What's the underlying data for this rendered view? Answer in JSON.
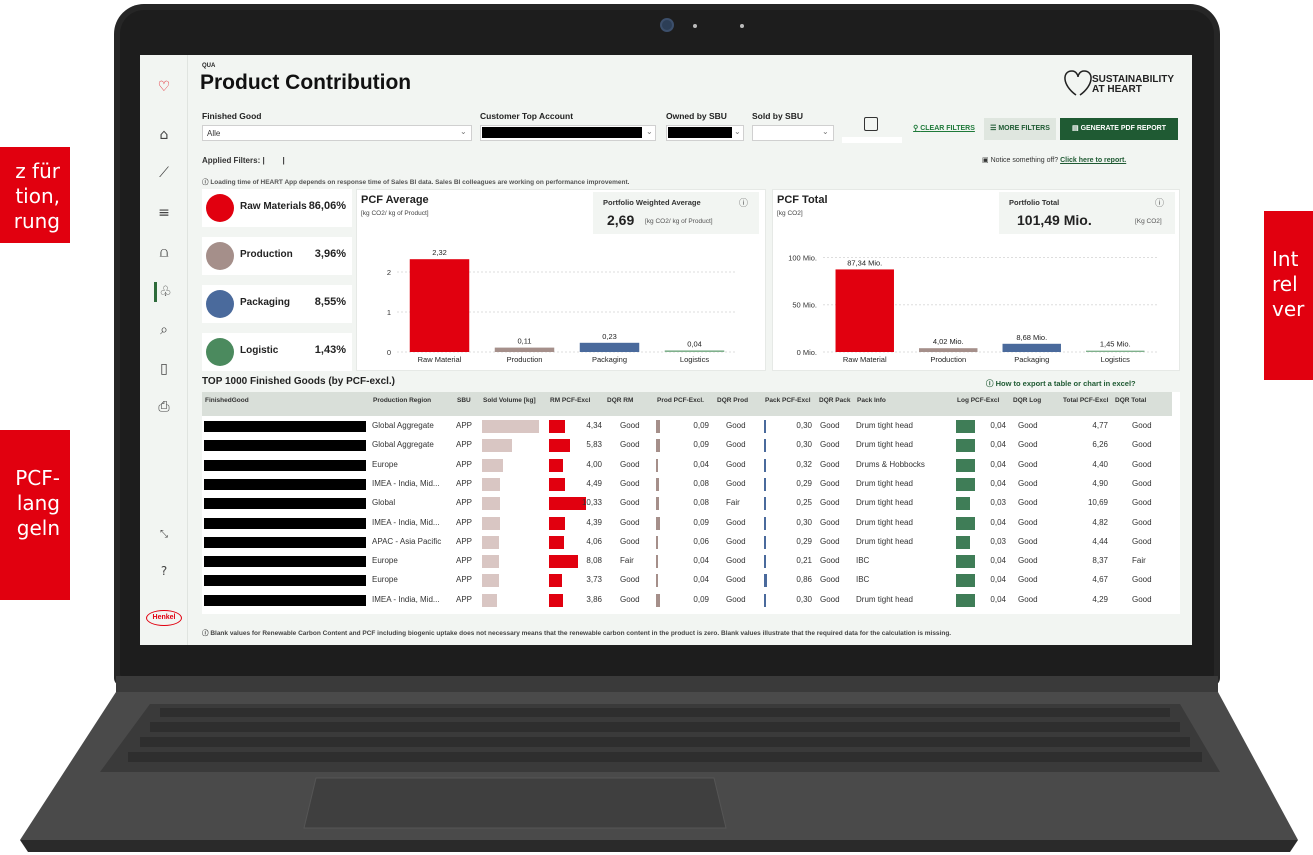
{
  "left_callouts": [
    "z für",
    "tion,",
    "rung",
    "PCF-",
    "lang",
    "geln"
  ],
  "right_callout": [
    "Int",
    "rel",
    "ver"
  ],
  "sidebar": {
    "icons": [
      "heart-icon",
      "home-icon",
      "trend-icon",
      "layers-icon",
      "bag-icon",
      "product-icon",
      "growth-icon",
      "grid-icon",
      "print-icon",
      "expand-icon",
      "help-icon"
    ],
    "brand": "Henkel"
  },
  "header": {
    "qua": "QUA",
    "title": "Product Contribution",
    "logo_text": "SUSTAINABILITY AT HEART"
  },
  "filters": {
    "finished_good": {
      "label": "Finished Good",
      "value": "Alle"
    },
    "customer_top_account": {
      "label": "Customer Top Account"
    },
    "owned_by_sbu": {
      "label": "Owned by SBU"
    },
    "sold_by_sbu": {
      "label": "Sold by SBU"
    },
    "clear_filters": "CLEAR FILTERS",
    "more_filters": "MORE FILTERS",
    "generate_report": "GENERATE PDF REPORT",
    "applied_filters": "Applied Filters: |        |",
    "notice_text": "Notice something off?",
    "notice_link": "Click here to report.",
    "loading_info": "Loading time of HEART App depends on response time of Sales BI data. Sales BI colleagues are working on performance improvement."
  },
  "categories": [
    {
      "label": "Raw Materials",
      "value": "86,06%",
      "color": "#e1000f"
    },
    {
      "label": "Production",
      "value": "3,96%",
      "color": "#a58f8a"
    },
    {
      "label": "Packaging",
      "value": "8,55%",
      "color": "#4a6a9c"
    },
    {
      "label": "Logistic",
      "value": "1,43%",
      "color": "#4b8a5e"
    }
  ],
  "pcf_average": {
    "title": "PCF Average",
    "unit": "[kg CO2/ kg of Product]",
    "kpi_label": "Portfolio Weighted Average",
    "kpi_value": "2,69",
    "kpi_unit": "[kg CO2/ kg of Product]",
    "y_ticks": [
      "2",
      "1",
      "0"
    ]
  },
  "pcf_total": {
    "title": "PCF Total",
    "unit": "[kg CO2]",
    "kpi_label": "Portfolio Total",
    "kpi_value": "101,49 Mio.",
    "kpi_unit": "[Kg CO2]",
    "y_ticks": [
      "100 Mio.",
      "50 Mio.",
      "0 Mio."
    ]
  },
  "chart_data": [
    {
      "type": "bar",
      "title": "PCF Average",
      "ylabel": "[kg CO2/ kg of Product]",
      "categories": [
        "Raw Material",
        "Production",
        "Packaging",
        "Logistics"
      ],
      "values": [
        2.32,
        0.11,
        0.23,
        0.04
      ],
      "labels": [
        "2,32",
        "0,11",
        "0,23",
        "0,04"
      ],
      "colors": [
        "#e1000f",
        "#a58f8a",
        "#4a6a9c",
        "#7fb08c"
      ],
      "ylim": [
        0,
        2.6
      ]
    },
    {
      "type": "bar",
      "title": "PCF Total",
      "ylabel": "[kg CO2]",
      "categories": [
        "Raw Material",
        "Production",
        "Packaging",
        "Logistics"
      ],
      "values": [
        87.34,
        4.02,
        8.68,
        1.45
      ],
      "labels": [
        "87,34 Mio.",
        "4,02 Mio.",
        "8,68 Mio.",
        "1,45 Mio."
      ],
      "colors": [
        "#e1000f",
        "#a58f8a",
        "#4a6a9c",
        "#7fb08c"
      ],
      "ylim": [
        0,
        110
      ]
    }
  ],
  "table": {
    "title": "TOP 1000 Finished Goods (by PCF-excl.)",
    "export_link": "How to export a table or chart in excel?",
    "columns": [
      "FinishedGood",
      "Production Region",
      "SBU",
      "Sold Volume [kg]",
      "RM PCF-Excl",
      "DQR RM",
      "Prod PCF-Excl.",
      "DQR Prod",
      "Pack PCF-Excl",
      "DQR Pack",
      "Pack Info",
      "Log PCF-Excl",
      "DQR Log",
      "Total PCF-Excl",
      "DQR Total"
    ],
    "rows": [
      {
        "region": "Global Aggregate",
        "sbu": "APP",
        "vol": 0.95,
        "rm": "4,34",
        "rm_v": 4.34,
        "dqr_rm": "Good",
        "prod": "0,09",
        "prod_v": 0.09,
        "dqr_prod": "Good",
        "pack": "0,30",
        "pack_v": 0.3,
        "dqr_pack": "Good",
        "info": "Drum tight head",
        "log": "0,04",
        "log_v": 0.04,
        "dqr_log": "Good",
        "total": "4,77",
        "dqr_total": "Good"
      },
      {
        "region": "Global Aggregate",
        "sbu": "APP",
        "vol": 0.5,
        "rm": "5,83",
        "rm_v": 5.83,
        "dqr_rm": "Good",
        "prod": "0,09",
        "prod_v": 0.09,
        "dqr_prod": "Good",
        "pack": "0,30",
        "pack_v": 0.3,
        "dqr_pack": "Good",
        "info": "Drum tight head",
        "log": "0,04",
        "log_v": 0.04,
        "dqr_log": "Good",
        "total": "6,26",
        "dqr_total": "Good"
      },
      {
        "region": "Europe",
        "sbu": "APP",
        "vol": 0.35,
        "rm": "4,00",
        "rm_v": 4.0,
        "dqr_rm": "Good",
        "prod": "0,04",
        "prod_v": 0.04,
        "dqr_prod": "Good",
        "pack": "0,32",
        "pack_v": 0.32,
        "dqr_pack": "Good",
        "info": "Drums & Hobbocks",
        "log": "0,04",
        "log_v": 0.04,
        "dqr_log": "Good",
        "total": "4,40",
        "dqr_total": "Good"
      },
      {
        "region": "IMEA - India, Mid...",
        "sbu": "APP",
        "vol": 0.3,
        "rm": "4,49",
        "rm_v": 4.49,
        "dqr_rm": "Good",
        "prod": "0,08",
        "prod_v": 0.08,
        "dqr_prod": "Good",
        "pack": "0,29",
        "pack_v": 0.29,
        "dqr_pack": "Good",
        "info": "Drum tight head",
        "log": "0,04",
        "log_v": 0.04,
        "dqr_log": "Good",
        "total": "4,90",
        "dqr_total": "Good"
      },
      {
        "region": "Global",
        "sbu": "APP",
        "vol": 0.3,
        "rm": "10,33",
        "rm_v": 10.33,
        "dqr_rm": "Good",
        "prod": "0,08",
        "prod_v": 0.08,
        "dqr_prod": "Fair",
        "pack": "0,25",
        "pack_v": 0.25,
        "dqr_pack": "Good",
        "info": "Drum tight head",
        "log": "0,03",
        "log_v": 0.03,
        "dqr_log": "Good",
        "total": "10,69",
        "dqr_total": "Good"
      },
      {
        "region": "IMEA - India, Mid...",
        "sbu": "APP",
        "vol": 0.3,
        "rm": "4,39",
        "rm_v": 4.39,
        "dqr_rm": "Good",
        "prod": "0,09",
        "prod_v": 0.09,
        "dqr_prod": "Good",
        "pack": "0,30",
        "pack_v": 0.3,
        "dqr_pack": "Good",
        "info": "Drum tight head",
        "log": "0,04",
        "log_v": 0.04,
        "dqr_log": "Good",
        "total": "4,82",
        "dqr_total": "Good"
      },
      {
        "region": "APAC - Asia Pacific",
        "sbu": "APP",
        "vol": 0.28,
        "rm": "4,06",
        "rm_v": 4.06,
        "dqr_rm": "Good",
        "prod": "0,06",
        "prod_v": 0.06,
        "dqr_prod": "Good",
        "pack": "0,29",
        "pack_v": 0.29,
        "dqr_pack": "Good",
        "info": "Drum tight head",
        "log": "0,03",
        "log_v": 0.03,
        "dqr_log": "Good",
        "total": "4,44",
        "dqr_total": "Good"
      },
      {
        "region": "Europe",
        "sbu": "APP",
        "vol": 0.28,
        "rm": "8,08",
        "rm_v": 8.08,
        "dqr_rm": "Fair",
        "prod": "0,04",
        "prod_v": 0.04,
        "dqr_prod": "Good",
        "pack": "0,21",
        "pack_v": 0.21,
        "dqr_pack": "Good",
        "info": "IBC",
        "log": "0,04",
        "log_v": 0.04,
        "dqr_log": "Good",
        "total": "8,37",
        "dqr_total": "Fair"
      },
      {
        "region": "Europe",
        "sbu": "APP",
        "vol": 0.28,
        "rm": "3,73",
        "rm_v": 3.73,
        "dqr_rm": "Good",
        "prod": "0,04",
        "prod_v": 0.04,
        "dqr_prod": "Good",
        "pack": "0,86",
        "pack_v": 0.86,
        "dqr_pack": "Good",
        "info": "IBC",
        "log": "0,04",
        "log_v": 0.04,
        "dqr_log": "Good",
        "total": "4,67",
        "dqr_total": "Good"
      },
      {
        "region": "IMEA - India, Mid...",
        "sbu": "APP",
        "vol": 0.25,
        "rm": "3,86",
        "rm_v": 3.86,
        "dqr_rm": "Good",
        "prod": "0,09",
        "prod_v": 0.09,
        "dqr_prod": "Good",
        "pack": "0,30",
        "pack_v": 0.3,
        "dqr_pack": "Good",
        "info": "Drum tight head",
        "log": "0,04",
        "log_v": 0.04,
        "dqr_log": "Good",
        "total": "4,29",
        "dqr_total": "Good"
      }
    ]
  },
  "footnote": "Blank values for Renewable Carbon Content and PCF including biogenic uptake does not necessary means that the renewable carbon content in the product is zero. Blank values illustrate that the required data for the calculation is missing."
}
